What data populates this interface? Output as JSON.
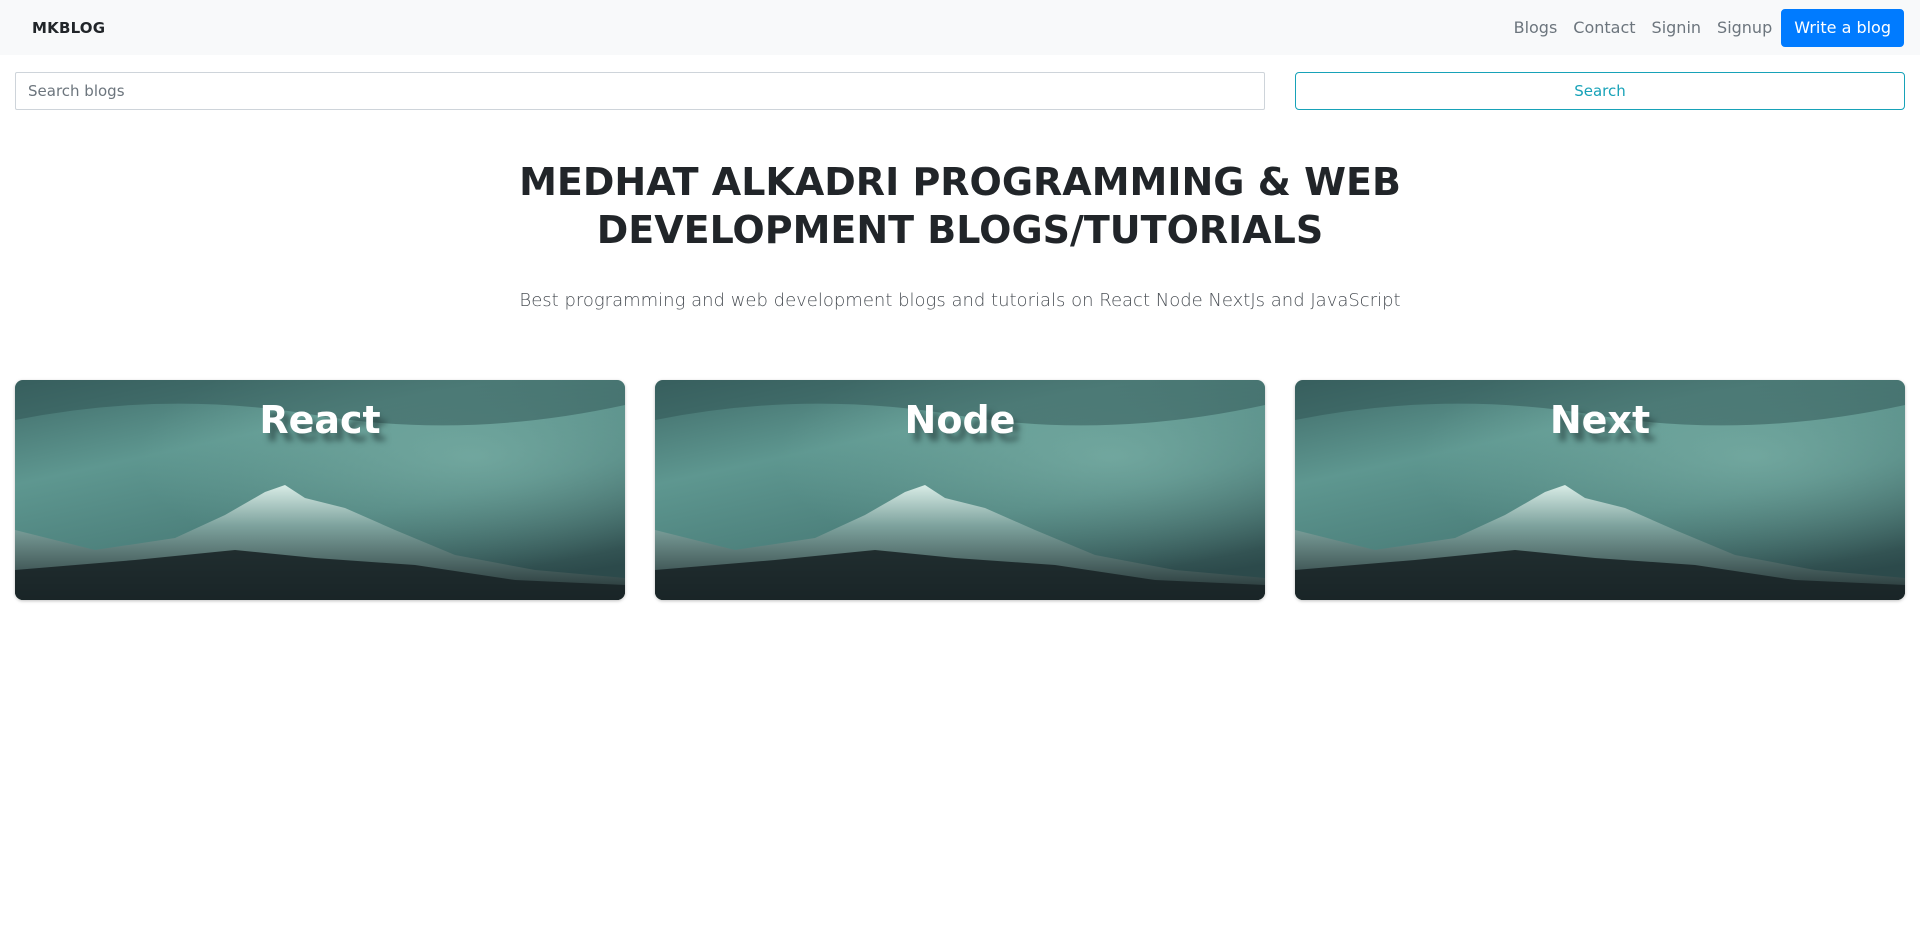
{
  "navbar": {
    "brand": "MKBLOG",
    "links": [
      "Blogs",
      "Contact",
      "Signin",
      "Signup"
    ],
    "write_button": "Write a blog"
  },
  "search": {
    "placeholder": "Search blogs",
    "button_label": "Search"
  },
  "hero": {
    "title": "MEDHAT ALKADRI PROGRAMMING & WEB DEVELOPMENT BLOGS/TUTORIALS",
    "subtitle": "Best programming and web development blogs and tutorials on React Node NextJs and JavaScript"
  },
  "cards": [
    {
      "title": "React"
    },
    {
      "title": "Node"
    },
    {
      "title": "Next"
    }
  ],
  "colors": {
    "primary": "#007bff",
    "info": "#17a2b8",
    "navbar_bg": "#f8f9fa"
  }
}
